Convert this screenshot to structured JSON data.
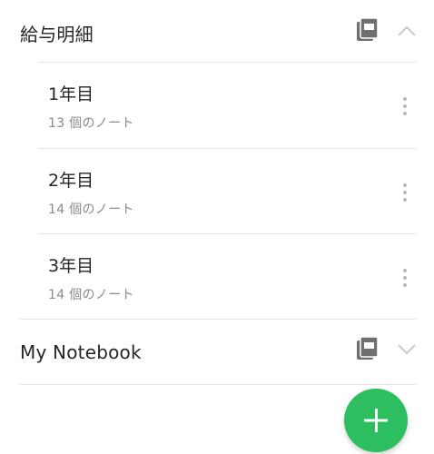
{
  "stacks": [
    {
      "title": "給与明細",
      "expanded": true,
      "icon": "notebook-stack-icon",
      "chevron": "chevron-up-icon",
      "notebooks": [
        {
          "title": "1年目",
          "count": "13 個のノート",
          "menu_icon": "more-vert-icon"
        },
        {
          "title": "2年目",
          "count": "14 個のノート",
          "menu_icon": "more-vert-icon"
        },
        {
          "title": "3年目",
          "count": "14 個のノート",
          "menu_icon": "more-vert-icon"
        }
      ]
    },
    {
      "title": "My Notebook",
      "expanded": false,
      "icon": "notebook-stack-icon",
      "chevron": "chevron-down-icon"
    }
  ],
  "fab": {
    "icon": "plus-icon"
  },
  "colors": {
    "accent": "#2dbe60",
    "text_primary": "#262626",
    "text_secondary": "#8a8a8a",
    "icon_gray": "#6f6f6f",
    "divider": "#e3e3e3"
  }
}
